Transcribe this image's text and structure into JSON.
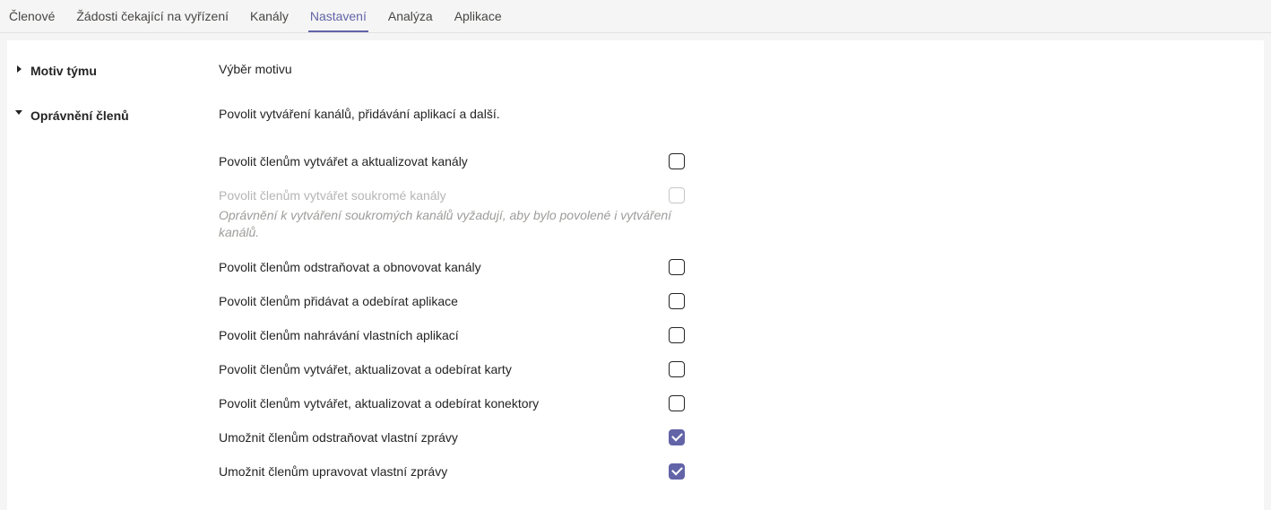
{
  "tabs": {
    "items": [
      {
        "label": "Členové",
        "active": false
      },
      {
        "label": "Žádosti čekající na vyřízení",
        "active": false
      },
      {
        "label": "Kanály",
        "active": false
      },
      {
        "label": "Nastavení",
        "active": true
      },
      {
        "label": "Analýza",
        "active": false
      },
      {
        "label": "Aplikace",
        "active": false
      }
    ]
  },
  "sections": {
    "theme": {
      "title": "Motiv týmu",
      "desc": "Výběr motivu"
    },
    "permissions": {
      "title": "Oprávnění členů",
      "desc": "Povolit vytváření kanálů, přidávání aplikací a další.",
      "options": [
        {
          "label": "Povolit členům vytvářet a aktualizovat kanály",
          "checked": false,
          "disabled": false
        },
        {
          "label": "Povolit členům vytvářet soukromé kanály",
          "checked": false,
          "disabled": true,
          "help": "Oprávnění k vytváření soukromých kanálů vyžadují, aby bylo povolené i vytváření kanálů."
        },
        {
          "label": "Povolit členům odstraňovat a obnovovat kanály",
          "checked": false,
          "disabled": false
        },
        {
          "label": "Povolit členům přidávat a odebírat aplikace",
          "checked": false,
          "disabled": false
        },
        {
          "label": "Povolit členům nahrávání vlastních aplikací",
          "checked": false,
          "disabled": false
        },
        {
          "label": "Povolit členům vytvářet, aktualizovat a odebírat karty",
          "checked": false,
          "disabled": false
        },
        {
          "label": "Povolit členům vytvářet, aktualizovat a odebírat konektory",
          "checked": false,
          "disabled": false
        },
        {
          "label": "Umožnit členům odstraňovat vlastní zprávy",
          "checked": true,
          "disabled": false
        },
        {
          "label": "Umožnit členům upravovat vlastní zprávy",
          "checked": true,
          "disabled": false
        }
      ]
    }
  }
}
